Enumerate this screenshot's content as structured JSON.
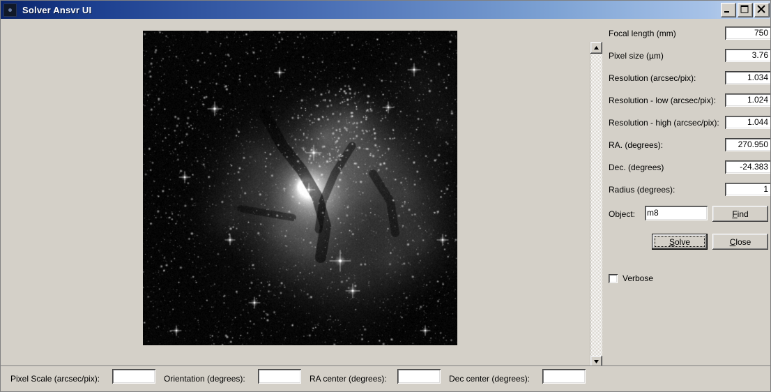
{
  "window": {
    "title": "Solver Ansvr UI",
    "icon": "app-icon",
    "controls": {
      "minimize": "_",
      "maximize": "□",
      "close": "✕"
    }
  },
  "image_viewer": {
    "alt": "M8 Lagoon Nebula grayscale astrophotograph",
    "scrollbars": {
      "vertical_up": "▲",
      "vertical_down": "▼",
      "horizontal_left": "◀",
      "horizontal_right": "▶"
    }
  },
  "panel": {
    "fields": [
      {
        "label": "Focal length (mm)",
        "value": "750",
        "name": "focal-length"
      },
      {
        "label": "Pixel size (µm)",
        "value": "3.76",
        "name": "pixel-size"
      },
      {
        "label": "Resolution (arcsec/pix):",
        "value": "1.034",
        "name": "resolution"
      },
      {
        "label": "Resolution - low (arcsec/pix):",
        "value": "1.024",
        "name": "resolution-low"
      },
      {
        "label": "Resolution - high (arcsec/pix):",
        "value": "1.044",
        "name": "resolution-high"
      },
      {
        "label": "RA. (degrees):",
        "value": "270.950",
        "name": "ra-degrees"
      },
      {
        "label": "Dec. (degrees)",
        "value": "-24.383",
        "name": "dec-degrees"
      },
      {
        "label": "Radius (degrees):",
        "value": "1",
        "name": "radius-degrees"
      }
    ],
    "object": {
      "label": "Object:",
      "value": "m8",
      "placeholder": ""
    },
    "buttons": {
      "find": {
        "accel": "F",
        "rest": "ind"
      },
      "solve": {
        "accel": "S",
        "rest": "olve"
      },
      "close": {
        "accel": "C",
        "rest": "lose"
      }
    },
    "verbose": {
      "label": "Verbose",
      "checked": false
    }
  },
  "statusbar": {
    "fields": [
      {
        "label": "Pixel Scale (arcsec/pix):",
        "value": "",
        "name": "pixel-scale"
      },
      {
        "label": "Orientation (degrees):",
        "value": "",
        "name": "orientation"
      },
      {
        "label": "RA center (degrees):",
        "value": "",
        "name": "ra-center"
      },
      {
        "label": "Dec center (degrees):",
        "value": "",
        "name": "dec-center"
      }
    ]
  },
  "colors": {
    "face": "#d4d0c8",
    "title_start": "#0a246a",
    "title_end": "#c8d8ee",
    "field_bg": "#ffffff"
  }
}
